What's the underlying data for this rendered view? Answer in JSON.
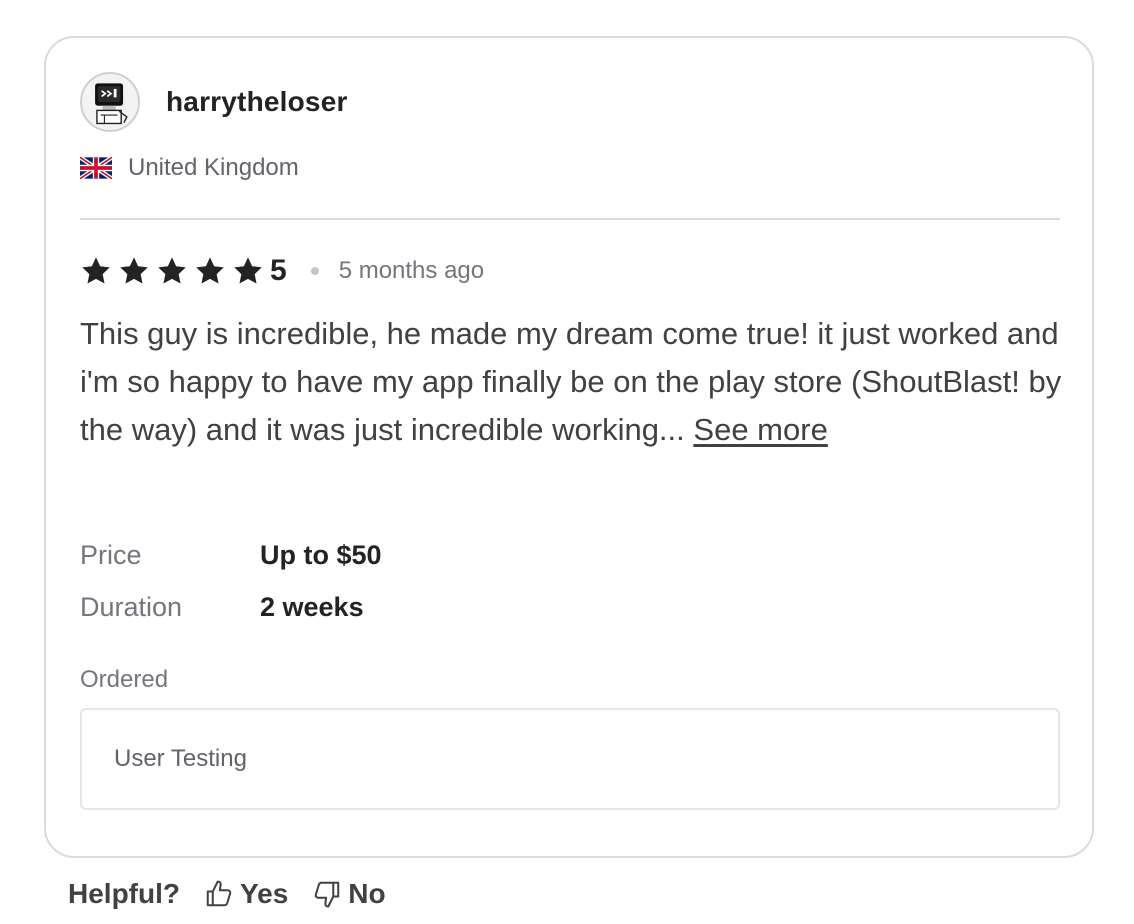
{
  "review": {
    "username": "harrytheloser",
    "country": "United Kingdom",
    "country_flag_icon": "uk-flag-icon",
    "avatar_icon": "computer-avatar-icon",
    "rating": "5",
    "stars_filled": 5,
    "time_ago": "5 months ago",
    "text": "This guy is incredible, he made my dream come true! it just worked and i'm so happy to have my app finally be on the play store (ShoutBlast! by the way) and it was just incredible working...",
    "see_more_label": "See more",
    "price_label": "Price",
    "price_value": "Up to $50",
    "duration_label": "Duration",
    "duration_value": "2 weeks",
    "ordered_label": "Ordered",
    "ordered_item": "User Testing"
  },
  "helpful": {
    "label": "Helpful?",
    "yes_label": "Yes",
    "no_label": "No",
    "yes_icon": "thumbs-up-icon",
    "no_icon": "thumbs-down-icon"
  },
  "colors": {
    "star": "#222325",
    "border": "#dadbdd",
    "text": "#404145",
    "muted": "#74767e"
  }
}
